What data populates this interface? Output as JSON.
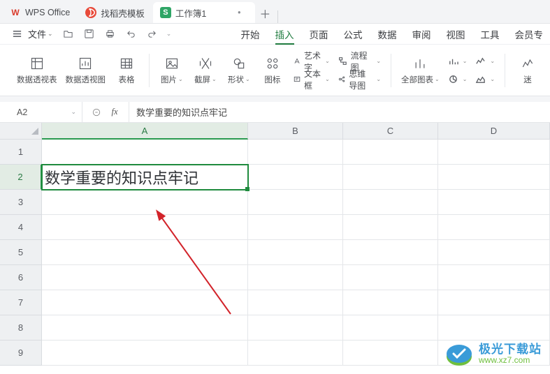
{
  "tabs": [
    {
      "label": "WPS Office",
      "icon": "wps",
      "active": false
    },
    {
      "label": "找稻壳模板",
      "icon": "docer",
      "active": false
    },
    {
      "label": "工作簿1",
      "icon": "sheet",
      "active": true
    }
  ],
  "file_label": "文件",
  "menu": [
    {
      "label": "开始",
      "active": false
    },
    {
      "label": "插入",
      "active": true
    },
    {
      "label": "页面",
      "active": false
    },
    {
      "label": "公式",
      "active": false
    },
    {
      "label": "数据",
      "active": false
    },
    {
      "label": "审阅",
      "active": false
    },
    {
      "label": "视图",
      "active": false
    },
    {
      "label": "工具",
      "active": false
    },
    {
      "label": "会员专"
    }
  ],
  "ribbon": {
    "pivot_table": "数据透视表",
    "pivot_chart": "数据透视图",
    "table": "表格",
    "picture": "图片",
    "screenshot": "截屏",
    "shape": "形状",
    "icon": "图标",
    "wordart": "艺术字",
    "textbox": "文本框",
    "flowchart": "流程图",
    "mindmap": "思维导图",
    "allcharts": "全部图表",
    "mystery": "迷"
  },
  "namebox": "A2",
  "formula_value": "数学重要的知识点牢记",
  "columns": [
    "A",
    "B",
    "C",
    "D"
  ],
  "rows": [
    "1",
    "2",
    "3",
    "4",
    "5",
    "6",
    "7",
    "8",
    "9"
  ],
  "selected_cell": {
    "row": 2,
    "col": "A",
    "value": "数学重要的知识点牢记"
  },
  "watermark": {
    "title": "极光下载站",
    "url": "www.xz7.com"
  }
}
